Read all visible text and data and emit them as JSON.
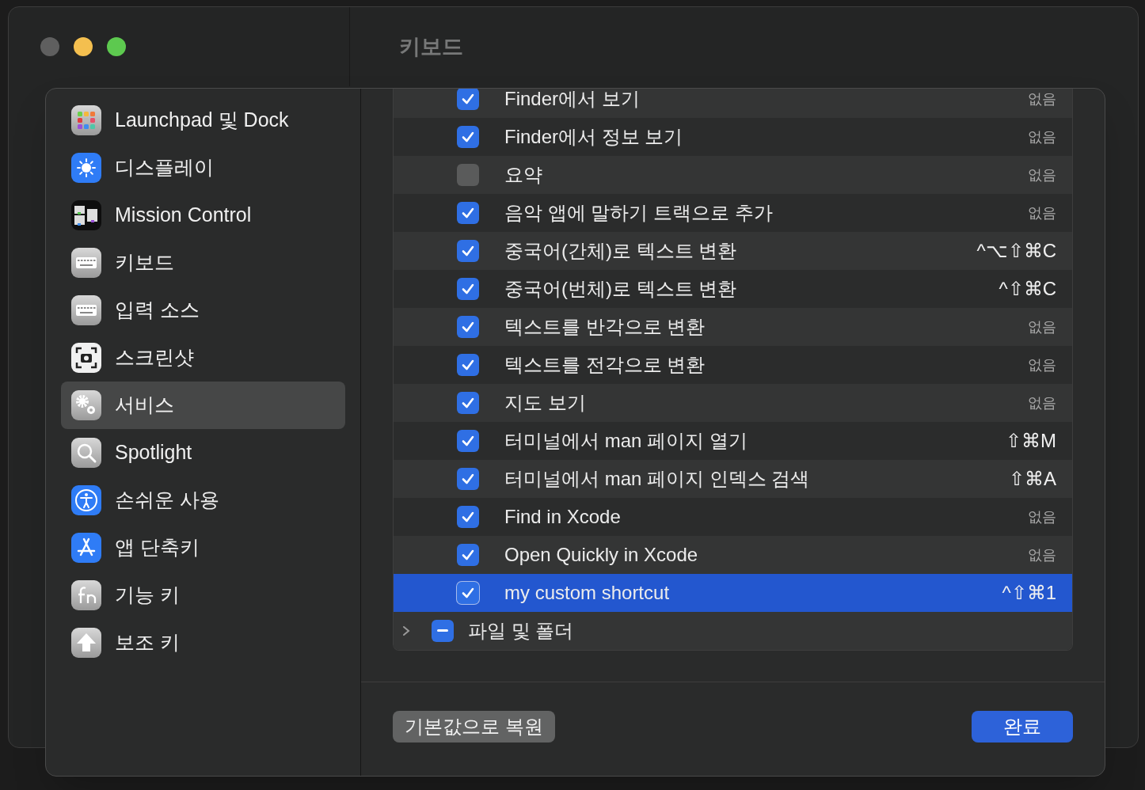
{
  "window": {
    "title": "키보드",
    "traffic_lights": [
      {
        "color": "#5f5f5f"
      },
      {
        "color": "#f4bf4f"
      },
      {
        "color": "#5dc94f"
      }
    ]
  },
  "sidebar": {
    "items": [
      {
        "label": "Launchpad 및 Dock",
        "selected": false
      },
      {
        "label": "디스플레이",
        "selected": false
      },
      {
        "label": "Mission Control",
        "selected": false
      },
      {
        "label": "키보드",
        "selected": false
      },
      {
        "label": "입력 소스",
        "selected": false
      },
      {
        "label": "스크린샷",
        "selected": false
      },
      {
        "label": "서비스",
        "selected": true
      },
      {
        "label": "Spotlight",
        "selected": false
      },
      {
        "label": "손쉬운 사용",
        "selected": false
      },
      {
        "label": "앱 단축키",
        "selected": false
      },
      {
        "label": "기능 키",
        "selected": false
      },
      {
        "label": "보조 키",
        "selected": false
      }
    ]
  },
  "services": {
    "rows": [
      {
        "kind": "item",
        "label": "Finder에서 보기",
        "checked": true,
        "selected": false,
        "assigned": false,
        "shortcut": "없음"
      },
      {
        "kind": "item",
        "label": "Finder에서 정보 보기",
        "checked": true,
        "selected": false,
        "assigned": false,
        "shortcut": "없음"
      },
      {
        "kind": "item",
        "label": "요약",
        "checked": false,
        "selected": false,
        "assigned": false,
        "shortcut": "없음"
      },
      {
        "kind": "item",
        "label": "음악 앱에 말하기 트랙으로 추가",
        "checked": true,
        "selected": false,
        "assigned": false,
        "shortcut": "없음"
      },
      {
        "kind": "item",
        "label": "중국어(간체)로 텍스트 변환",
        "checked": true,
        "selected": false,
        "assigned": true,
        "shortcut": "^⌥⇧⌘C"
      },
      {
        "kind": "item",
        "label": "중국어(번체)로 텍스트 변환",
        "checked": true,
        "selected": false,
        "assigned": true,
        "shortcut": "^⇧⌘C"
      },
      {
        "kind": "item",
        "label": "텍스트를 반각으로 변환",
        "checked": true,
        "selected": false,
        "assigned": false,
        "shortcut": "없음"
      },
      {
        "kind": "item",
        "label": "텍스트를 전각으로 변환",
        "checked": true,
        "selected": false,
        "assigned": false,
        "shortcut": "없음"
      },
      {
        "kind": "item",
        "label": "지도 보기",
        "checked": true,
        "selected": false,
        "assigned": false,
        "shortcut": "없음"
      },
      {
        "kind": "item",
        "label": "터미널에서 man 페이지 열기",
        "checked": true,
        "selected": false,
        "assigned": true,
        "shortcut": "⇧⌘M"
      },
      {
        "kind": "item",
        "label": "터미널에서 man 페이지 인덱스 검색",
        "checked": true,
        "selected": false,
        "assigned": true,
        "shortcut": "⇧⌘A"
      },
      {
        "kind": "item",
        "label": "Find in Xcode",
        "checked": true,
        "selected": false,
        "assigned": false,
        "shortcut": "없음"
      },
      {
        "kind": "item",
        "label": "Open Quickly in Xcode",
        "checked": true,
        "selected": false,
        "assigned": false,
        "shortcut": "없음"
      },
      {
        "kind": "item",
        "label": "my custom shortcut",
        "checked": true,
        "selected": true,
        "assigned": true,
        "shortcut": "^⇧⌘1"
      },
      {
        "kind": "group",
        "label": "파일 및 폴더",
        "checked": true,
        "mixed": true,
        "expanded": false,
        "selected": false
      }
    ]
  },
  "buttons": [
    {
      "kind": "secondary",
      "label": "기본값으로 복원"
    },
    {
      "kind": "primary",
      "label": "완료"
    }
  ]
}
